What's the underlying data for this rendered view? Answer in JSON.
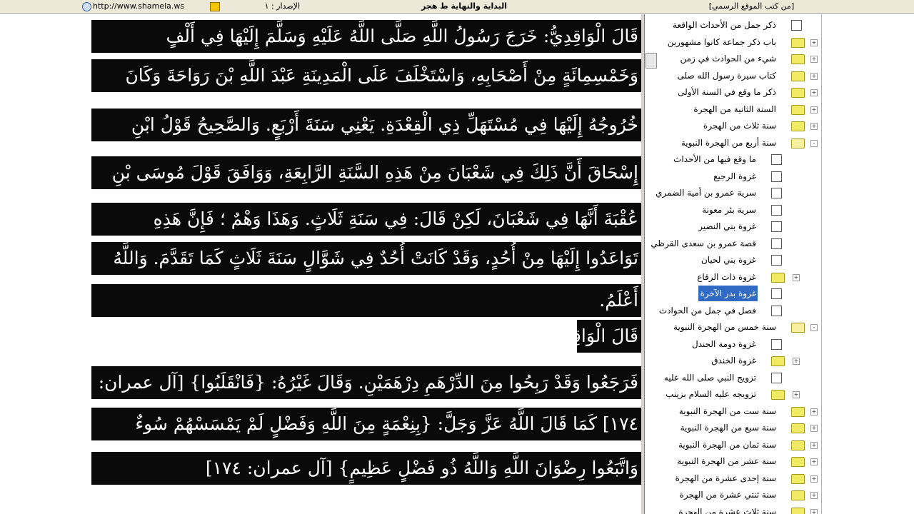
{
  "topbar": {
    "url": "http://www.shamela.ws",
    "edition": "الإصدار : ١",
    "book_title": "البداية والنهاية ط هجر",
    "official_books": "[من كتب الموقع الرسمي]"
  },
  "reader": {
    "lines": [
      "قَالَ الْوَاقِدِيُّ: خَرَجَ رَسُولُ اللَّهِ صَلَّى اللَّهُ عَلَيْهِ وَسَلَّمَ إِلَيْهَا فِي أَلْفٍ",
      "وَخَمْسِمِائَةٍ مِنْ أَصْحَابِهِ، وَاسْتَخْلَفَ عَلَى الْمَدِينَةِ عَبْدَ اللَّهِ بْنَ رَوَاحَةَ وَكَانَ",
      "خُرُوجُهُ إِلَيْهَا فِي مُسْتَهَلِّ ذِي الْقِعْدَةِ. يَعْنِي سَنَةَ أَرْبَعٍ. وَالصَّحِيحُ قَوْلُ ابْنِ",
      "إِسْحَاقَ أَنَّ ذَلِكَ فِي شَعْبَانَ مِنْ هَذِهِ السَّنَةِ الرَّابِعَةِ، وَوَافَقَ قَوْلَ مُوسَى بْنِ",
      "عُقْبَةَ أَنَّهَا فِي شَعْبَانَ، لَكِنْ قَالَ: فِي سَنَةِ ثَلَاثٍ. وَهَذَا وَهْمٌ ؛ فَإِنَّ هَذِهِ",
      "تَوَاعَدُوا إِلَيْهَا مِنْ أُحُدٍ، وَقَدْ كَانَتْ أُحُدٌ فِي شَوَّالٍ سَنَةَ ثَلَاثٍ كَمَا تَقَدَّمَ. وَاللَّهُ",
      "أَعْلَمُ.",
      "قَالَ الْوَاقِدِيُّ: فَأَقَامُوا بِبَدْرٍ مُدَّةَ الْمَوْسِمِ الَّذِي كَانَ يُعْقَدُ فِيهَا ثَمَانِيَةَ أَيَّامٍ،",
      "فَرَجَعُوا وَقَدْ رَبِحُوا مِنَ الدِّرْهَمِ دِرْهَمَيْنِ. وَقَالَ غَيْرُهُ: {فَانْقَلَبُوا} [آل عمران:",
      "١٧٤] كَمَا قَالَ اللَّهُ عَزَّ وَجَلَّ: {بِنِعْمَةٍ مِنَ اللَّهِ وَفَضْلٍ لَمْ يَمْسَسْهُمْ سُوءٌ",
      "وَاتَّبَعُوا رِضْوَانَ اللَّهِ وَاللَّهُ ذُو فَضْلٍ عَظِيمٍ} [آل عمران: ١٧٤]"
    ]
  },
  "tree": {
    "items": [
      {
        "label": "ذكر جمل من الأحداث الواقعة",
        "kind": "checkbox",
        "expander": ""
      },
      {
        "label": "باب ذكر جماعة كانوا مشهورين",
        "kind": "folder",
        "expander": "+"
      },
      {
        "label": "شيء من الحوادث في زمن",
        "kind": "folder",
        "expander": "+"
      },
      {
        "label": "كتاب سيرة رسول الله صلى",
        "kind": "folder",
        "expander": "+"
      },
      {
        "label": "ذكر ما وقع في السنة الأولى",
        "kind": "folder",
        "expander": "+"
      },
      {
        "label": "السنة الثانية من الهجرة",
        "kind": "folder",
        "expander": "+"
      },
      {
        "label": "سنة ثلاث من الهجرة",
        "kind": "folder",
        "expander": "+"
      },
      {
        "label": "سنة أربع من الهجرة النبوية",
        "kind": "folder-open",
        "expander": "-"
      },
      {
        "label": "ما وقع فيها من الأحداث",
        "kind": "checkbox",
        "expander": ""
      },
      {
        "label": "غزوة الرجيع",
        "kind": "checkbox",
        "expander": ""
      },
      {
        "label": "سرية عمرو بن أمية الضمري",
        "kind": "checkbox",
        "expander": ""
      },
      {
        "label": "سرية بئر معونة",
        "kind": "checkbox",
        "expander": ""
      },
      {
        "label": "غزوة بني النضير",
        "kind": "checkbox",
        "expander": ""
      },
      {
        "label": "قصة عمرو بن سعدى القرظي",
        "kind": "checkbox",
        "expander": ""
      },
      {
        "label": "غزوة بني لحيان",
        "kind": "checkbox",
        "expander": ""
      },
      {
        "label": "غزوة ذات الرقاع",
        "kind": "folder",
        "expander": "+"
      },
      {
        "label": "غزوة بدر الآخرة",
        "kind": "checkbox",
        "expander": "",
        "selected": true
      },
      {
        "label": "فصل في جمل من الحوادث",
        "kind": "checkbox",
        "expander": ""
      },
      {
        "label": "سنة خمس من الهجرة النبوية",
        "kind": "folder-open",
        "expander": "-"
      },
      {
        "label": "غزوة دومة الجندل",
        "kind": "checkbox",
        "expander": ""
      },
      {
        "label": "غزوة الخندق",
        "kind": "folder",
        "expander": "+"
      },
      {
        "label": "تزويج النبي صلى الله عليه",
        "kind": "checkbox",
        "expander": ""
      },
      {
        "label": "تزويجه عليه السلام بزينب",
        "kind": "folder",
        "expander": "+"
      },
      {
        "label": "سنة ست من الهجرة النبوية",
        "kind": "folder",
        "expander": "+"
      },
      {
        "label": "سنة سبع من الهجرة النبوية",
        "kind": "folder",
        "expander": "+"
      },
      {
        "label": "سنة ثمان من الهجرة النبوية",
        "kind": "folder",
        "expander": "+"
      },
      {
        "label": "سنة عشر من الهجرة النبوية",
        "kind": "folder",
        "expander": "+"
      },
      {
        "label": "سنة إحدى عشرة من الهجرة",
        "kind": "folder",
        "expander": "+"
      },
      {
        "label": "سنة ثنتي عشرة من الهجرة",
        "kind": "folder",
        "expander": "+"
      },
      {
        "label": "سنة ثلاث عشرة من الهجرة",
        "kind": "folder",
        "expander": "+"
      }
    ]
  }
}
